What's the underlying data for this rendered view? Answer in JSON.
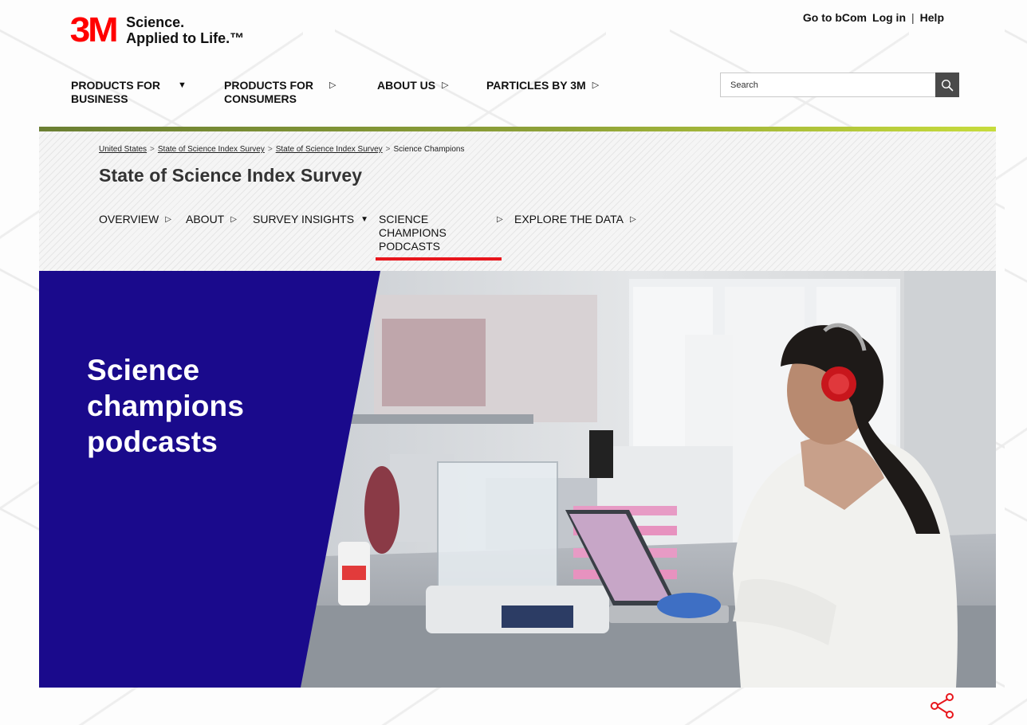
{
  "header": {
    "logo_mark": "3M",
    "tagline_line1": "Science.",
    "tagline_line2": "Applied to Life.™",
    "utility": {
      "bcom": "Go to bCom",
      "login": "Log in",
      "separator": "|",
      "help": "Help"
    },
    "nav": [
      {
        "label": "PRODUCTS FOR\nBUSINESS",
        "arrow": "▼"
      },
      {
        "label": "PRODUCTS FOR\nCONSUMERS",
        "arrow": "▷"
      },
      {
        "label": "ABOUT US",
        "arrow": "▷"
      },
      {
        "label": "PARTICLES BY 3M",
        "arrow": "▷"
      }
    ],
    "search": {
      "placeholder": "Search",
      "icon": "search-icon"
    }
  },
  "breadcrumb": [
    {
      "label": "United States"
    },
    {
      "label": "State of Science Index Survey"
    },
    {
      "label": "State of Science Index Survey"
    },
    {
      "label": "Science Champions"
    }
  ],
  "breadcrumb_separator": ">",
  "section_title": "State of Science Index Survey",
  "subnav": [
    {
      "label": "OVERVIEW",
      "arrow": "▷"
    },
    {
      "label": "ABOUT",
      "arrow": "▷"
    },
    {
      "label": "SURVEY INSIGHTS",
      "arrow": "▼"
    },
    {
      "label": "SCIENCE\nCHAMPIONS\nPODCASTS",
      "arrow": "▷",
      "active": true
    },
    {
      "label": "EXPLORE THE DATA",
      "arrow": "▷"
    }
  ],
  "hero": {
    "title": "Science\nchampions\npodcasts",
    "panel_color": "#1a0a8c"
  },
  "share": {
    "icon": "share-icon",
    "color": "#e8161c"
  },
  "colors": {
    "brand_red": "#ff0000",
    "accent_red": "#e8161c",
    "hero_blue": "#1a0a8c",
    "green_bar_start": "#6b7f33",
    "green_bar_end": "#c7dc3c"
  }
}
